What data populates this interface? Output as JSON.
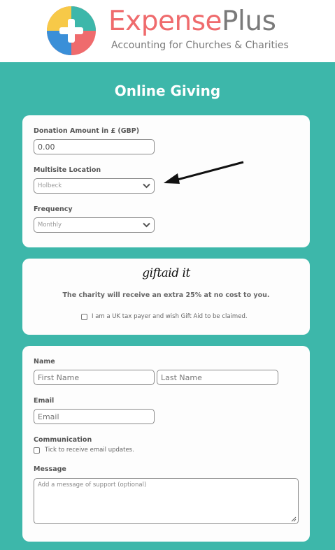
{
  "brand": {
    "name_part1": "Expense",
    "name_part2": "Plus",
    "tagline": "Accounting for Churches & Charities"
  },
  "page": {
    "title": "Online Giving"
  },
  "donation": {
    "amount_label": "Donation Amount in £ (GBP)",
    "amount_value": "0.00",
    "location_label": "Multisite Location",
    "location_value": "Holbeck",
    "frequency_label": "Frequency",
    "frequency_value": "Monthly"
  },
  "giftaid": {
    "logo_text": "giftaid it",
    "message": "The charity will receive an extra 25% at no cost to you.",
    "checkbox_label": "I am a UK tax payer and wish Gift Aid to be claimed."
  },
  "contact": {
    "name_label": "Name",
    "first_name_placeholder": "First Name",
    "last_name_placeholder": "Last Name",
    "email_label": "Email",
    "email_placeholder": "Email",
    "communication_label": "Communication",
    "communication_checkbox_label": "Tick to receive email updates.",
    "message_label": "Message",
    "message_placeholder": "Add a message of support (optional)"
  },
  "colors": {
    "teal": "#3db7aa",
    "brand_red": "#ef6b6d",
    "brand_grey": "#7a7a7a"
  },
  "icons": [
    "plus-logo-icon",
    "chevron-down-icon",
    "arrow-annotation-icon",
    "resize-grip-icon"
  ]
}
